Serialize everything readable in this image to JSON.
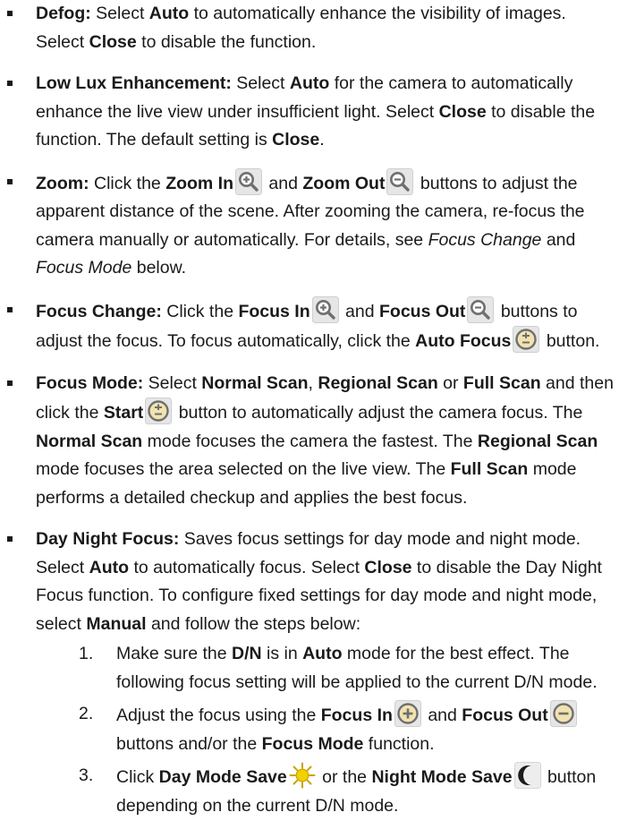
{
  "items": [
    {
      "name": "defog",
      "segments": [
        {
          "t": "Defog:",
          "s": "b"
        },
        {
          "t": " Select "
        },
        {
          "t": "Auto",
          "s": "b"
        },
        {
          "t": " to automatically enhance the visibility of images. Select "
        },
        {
          "t": "Close",
          "s": "b"
        },
        {
          "t": " to disable the function."
        }
      ]
    },
    {
      "name": "low-lux-enhancement",
      "segments": [
        {
          "t": "Low Lux Enhancement:",
          "s": "b"
        },
        {
          "t": " Select "
        },
        {
          "t": "Auto",
          "s": "b"
        },
        {
          "t": " for the camera to automatically enhance the live view under insufficient light. Select "
        },
        {
          "t": "Close",
          "s": "b"
        },
        {
          "t": " to disable the function. The default setting is "
        },
        {
          "t": "Close",
          "s": "b"
        },
        {
          "t": "."
        }
      ]
    },
    {
      "name": "zoom",
      "segments": [
        {
          "t": "Zoom:",
          "s": "b"
        },
        {
          "t": " Click the "
        },
        {
          "t": "Zoom In",
          "s": "b"
        },
        {
          "icon": "zoom-in"
        },
        {
          "t": " and "
        },
        {
          "t": "Zoom Out",
          "s": "b"
        },
        {
          "icon": "zoom-out"
        },
        {
          "t": " buttons to adjust the apparent distance of the scene. After zooming the camera, re-focus the camera manually or automatically. For details, see "
        },
        {
          "t": "Focus Change",
          "s": "i"
        },
        {
          "t": " and "
        },
        {
          "t": "Focus Mode",
          "s": "i"
        },
        {
          "t": " below."
        }
      ]
    },
    {
      "name": "focus-change",
      "segments": [
        {
          "t": "Focus Change:",
          "s": "b"
        },
        {
          "t": " Click the "
        },
        {
          "t": "Focus In",
          "s": "b"
        },
        {
          "icon": "zoom-in"
        },
        {
          "t": " and "
        },
        {
          "t": "Focus Out",
          "s": "b"
        },
        {
          "icon": "zoom-out"
        },
        {
          "t": " buttons to adjust the focus. To focus automatically, click the "
        },
        {
          "t": "Auto Focus",
          "s": "b"
        },
        {
          "icon": "auto-focus"
        },
        {
          "t": " button."
        }
      ]
    },
    {
      "name": "focus-mode",
      "segments": [
        {
          "t": "Focus Mode:",
          "s": "b"
        },
        {
          "t": " Select "
        },
        {
          "t": "Normal Scan",
          "s": "b"
        },
        {
          "t": ", "
        },
        {
          "t": "Regional Scan",
          "s": "b"
        },
        {
          "t": " or "
        },
        {
          "t": "Full Scan",
          "s": "b"
        },
        {
          "t": " and then click the "
        },
        {
          "t": "Start",
          "s": "b"
        },
        {
          "icon": "start"
        },
        {
          "t": " button to automatically adjust the camera focus. The "
        },
        {
          "t": "Normal Scan",
          "s": "b"
        },
        {
          "t": " mode focuses the camera the fastest. The "
        },
        {
          "t": "Regional Scan",
          "s": "b"
        },
        {
          "t": " mode focuses the area selected on the live view. The "
        },
        {
          "t": "Full Scan",
          "s": "b"
        },
        {
          "t": " mode performs a detailed checkup and applies the best focus."
        }
      ]
    },
    {
      "name": "day-night-focus",
      "segments": [
        {
          "t": "Day Night Focus:",
          "s": "b"
        },
        {
          "t": " Saves focus settings for day mode and night mode. Select "
        },
        {
          "t": "Auto",
          "s": "b"
        },
        {
          "t": " to automatically focus. Select "
        },
        {
          "t": "Close",
          "s": "b"
        },
        {
          "t": " to disable the Day Night Focus function. To configure fixed settings for day mode and night mode, select "
        },
        {
          "t": "Manual",
          "s": "b"
        },
        {
          "t": " and follow the steps below:"
        }
      ],
      "steps": [
        {
          "num": "1.",
          "segments": [
            {
              "t": "Make sure the "
            },
            {
              "t": "D/N",
              "s": "b"
            },
            {
              "t": " is in "
            },
            {
              "t": "Auto",
              "s": "b"
            },
            {
              "t": " mode for the best effect. The following focus setting will be applied to the current D/N mode."
            }
          ]
        },
        {
          "num": "2.",
          "segments": [
            {
              "t": "Adjust the focus using the "
            },
            {
              "t": "Focus In",
              "s": "b"
            },
            {
              "icon": "focus-in"
            },
            {
              "t": " and "
            },
            {
              "t": "Focus Out",
              "s": "b"
            },
            {
              "icon": "focus-out"
            },
            {
              "t": " buttons and/or the "
            },
            {
              "t": "Focus Mode",
              "s": "b"
            },
            {
              "t": " function."
            }
          ]
        },
        {
          "num": "3.",
          "segments": [
            {
              "t": "Click "
            },
            {
              "t": "Day Mode Save",
              "s": "b"
            },
            {
              "icon": "day-mode"
            },
            {
              "t": " or the "
            },
            {
              "t": "Night Mode Save",
              "s": "b"
            },
            {
              "icon": "night-mode"
            },
            {
              "t": " button depending on the current D/N mode."
            }
          ]
        }
      ]
    }
  ]
}
